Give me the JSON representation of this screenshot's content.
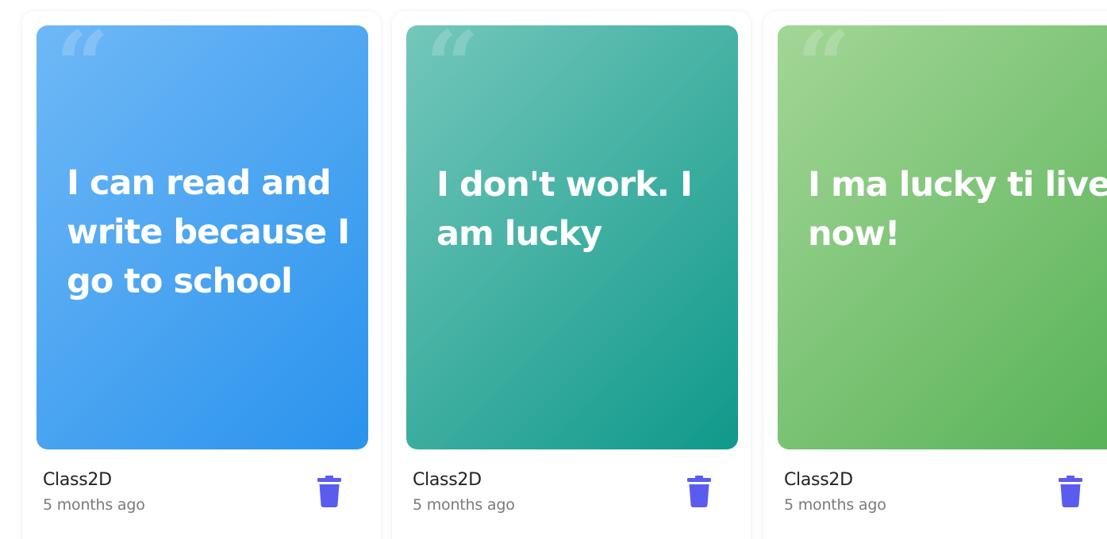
{
  "colors": {
    "accent_delete": "#5a5cf0",
    "card_gradients": [
      [
        "#6fb8f6",
        "#2a93ed"
      ],
      [
        "#74c7bb",
        "#0f998a"
      ],
      [
        "#a3d697",
        "#57b256"
      ]
    ]
  },
  "quote_mark": "“",
  "cards": [
    {
      "quote": "I can read and write because I go to school",
      "author": "Class2D",
      "time": "5 months ago",
      "delete_icon": "trash-icon"
    },
    {
      "quote": "I don't work. I am lucky",
      "author": "Class2D",
      "time": "5 months ago",
      "delete_icon": "trash-icon"
    },
    {
      "quote": "I ma lucky ti live now!",
      "author": "Class2D",
      "time": "5 months ago",
      "delete_icon": "trash-icon"
    }
  ]
}
